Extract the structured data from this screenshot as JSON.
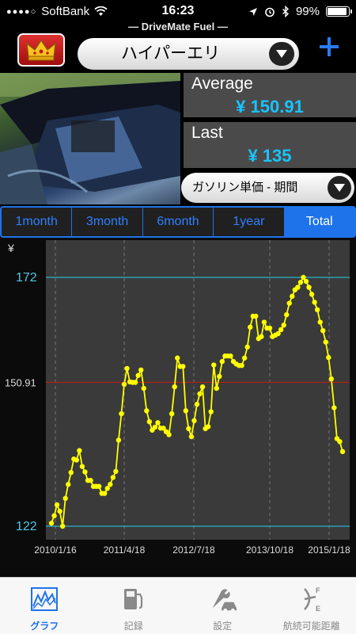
{
  "status_bar": {
    "carrier": "SoftBank",
    "time": "16:23",
    "battery": "99%"
  },
  "app_title": "DriveMate Fuel",
  "car_selector": {
    "value": "ハイパーエリ"
  },
  "stats": {
    "average_label": "Average",
    "average_value": "¥ 150.91",
    "last_label": "Last",
    "last_value": "¥ 135"
  },
  "period_selector": {
    "value": "ガソリン単価 - 期間"
  },
  "tabs": [
    {
      "label": "1month"
    },
    {
      "label": "3month"
    },
    {
      "label": "6month"
    },
    {
      "label": "1year"
    },
    {
      "label": "Total"
    }
  ],
  "active_tab": 4,
  "chart_data": {
    "type": "line",
    "ylabel": "¥",
    "ylim": [
      122,
      172
    ],
    "y_ticks": [
      "172",
      "150.91",
      "122"
    ],
    "reference_lines": [
      {
        "value": 172,
        "color": "#2bb3c7"
      },
      {
        "value": 150.91,
        "color": "#c01a1a"
      },
      {
        "value": 122,
        "color": "#2bb3c7"
      }
    ],
    "x_ticks": [
      "2010/1/16",
      "2011/4/18",
      "2012/7/18",
      "2013/10/18",
      "2015/1/18"
    ],
    "line_color": "#ffff00",
    "series": [
      {
        "values": [
          122.6,
          124.1,
          126.3,
          125.0,
          122.0,
          127.6,
          130.4,
          132.8,
          135.5,
          135.3,
          137.2,
          134.0,
          132.9,
          131.2,
          131.2,
          130.0,
          130.0,
          130.0,
          128.6,
          128.6,
          129.6,
          130.4,
          131.8,
          133.0,
          139.3,
          144.6,
          150.5,
          153.7,
          151.0,
          150.9,
          150.9,
          152.3,
          153.4,
          149.7,
          145.2,
          143.0,
          141.3,
          141.9,
          142.8,
          141.7,
          141.7,
          141.0,
          140.4,
          144.6,
          150.0,
          155.8,
          154.1,
          154.1,
          145.2,
          141.6,
          140.0,
          143.2,
          146.5,
          148.6,
          150.0,
          141.6,
          142.0,
          145.0,
          154.4,
          149.7,
          152.1,
          155.1,
          156.2,
          156.2,
          156.2,
          155.1,
          154.6,
          154.3,
          154.3,
          155.8,
          158.0,
          162.0,
          164.2,
          164.2,
          159.7,
          160.1,
          163.0,
          161.8,
          161.8,
          160.1,
          160.4,
          160.7,
          161.5,
          162.4,
          164.5,
          166.8,
          168.2,
          169.5,
          170.0,
          171.0,
          172.0,
          171.2,
          170.0,
          168.6,
          167.0,
          165.5,
          163.0,
          161.3,
          159.0,
          155.9,
          151.6,
          145.8,
          139.6,
          139.0,
          137.0
        ]
      }
    ]
  },
  "bottom_tabs": [
    {
      "label": "グラフ",
      "icon": "graph-icon"
    },
    {
      "label": "記録",
      "icon": "fuel-pump-icon"
    },
    {
      "label": "設定",
      "icon": "wrench-car-icon"
    },
    {
      "label": "航続可能距離",
      "icon": "fuel-gauge-icon"
    }
  ],
  "colors": {
    "accent": "#1f73ea",
    "value_text": "#19c3ff",
    "crown_button": "#c81a1a"
  }
}
